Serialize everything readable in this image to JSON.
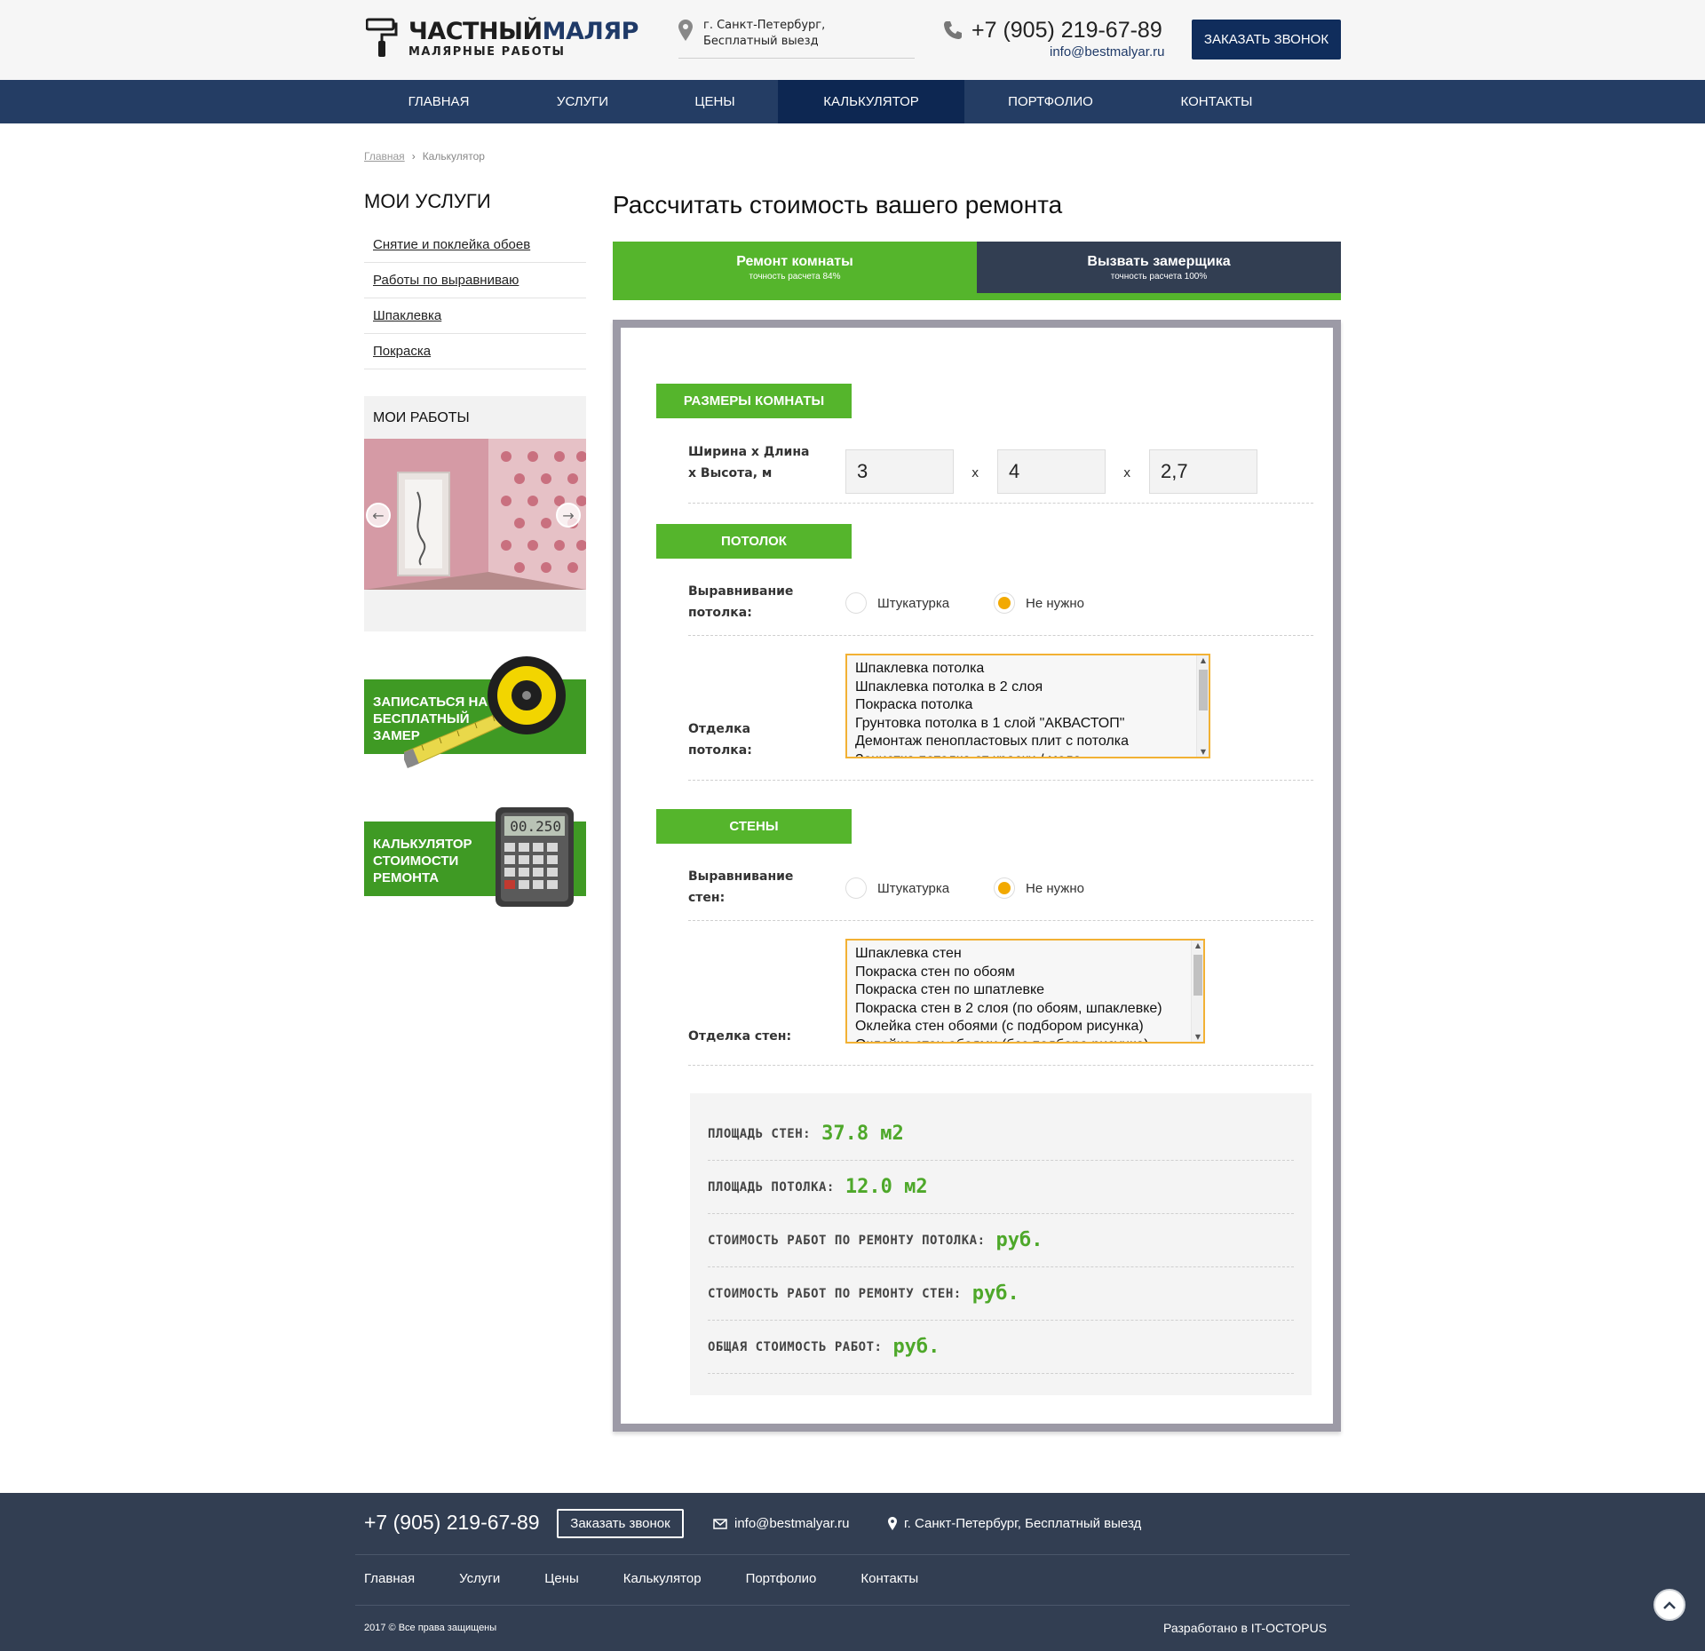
{
  "header": {
    "logo_part1": "ЧАСТНЫЙ",
    "logo_part2": "МАЛЯР",
    "logo_sub": "МАЛЯРНЫЕ РАБОТЫ",
    "location_line1": "г. Санкт-Петербург,",
    "location_line2": "Бесплатный выезд",
    "phone": "+7 (905) 219-67-89",
    "email": "info@bestmalyar.ru",
    "call_button": "ЗАКАЗАТЬ ЗВОНОК"
  },
  "nav": [
    {
      "label": "ГЛАВНАЯ"
    },
    {
      "label": "УСЛУГИ"
    },
    {
      "label": "ЦЕНЫ"
    },
    {
      "label": "КАЛЬКУЛЯТОР",
      "active": true
    },
    {
      "label": "ПОРТФОЛИО"
    },
    {
      "label": "КОНТАКТЫ"
    }
  ],
  "breadcrumb": {
    "home": "Главная",
    "current": "Калькулятор"
  },
  "sidebar": {
    "title": "МОИ УСЛУГИ",
    "items": [
      {
        "label": "Снятие и поклейка обоев"
      },
      {
        "label": "Работы по выравниваю"
      },
      {
        "label": "Шпаклевка"
      },
      {
        "label": "Покраска"
      }
    ],
    "works_title": "МОИ РАБОТЫ",
    "promo1": "ЗАПИСАТЬСЯ НА БЕСПЛАТНЫЙ ЗАМЕР",
    "promo2": "КАЛЬКУЛЯТОР СТОИМОСТИ РЕМОНТА",
    "calc_display": "00.250"
  },
  "main": {
    "title": "Рассчитать стоимость вашего ремонта",
    "tabs": [
      {
        "label": "Ремонт комнаты",
        "sub": "точность расчета 84%"
      },
      {
        "label": "Вызвать замерщика",
        "sub": "точность расчета 100%"
      }
    ],
    "room": {
      "header": "РАЗМЕРЫ КОМНАТЫ",
      "label_line1": "Ширина х Длина",
      "label_line2": "х Высота, м",
      "width": "3",
      "length": "4",
      "height": "2,7",
      "x": "х"
    },
    "ceiling": {
      "header": "ПОТОЛОК",
      "align_label_line1": "Выравнивание",
      "align_label_line2": "потолка:",
      "opt_plaster": "Штукатурка",
      "opt_none": "Не нужно",
      "selected": "Не нужно",
      "finish_label_line1": "Отделка",
      "finish_label_line2": "потолка:",
      "finish_options": [
        "Шпаклевка потолка",
        "Шпаклевка потолка в 2 слоя",
        "Покраска потолка",
        "Грунтовка потолка в 1 слой \"АКВАСТОП\"",
        "Демонтаж пенопластовых плит с потолка",
        "Зачистка потолка от краски / мела"
      ]
    },
    "walls": {
      "header": "СТЕНЫ",
      "align_label_line1": "Выравнивание",
      "align_label_line2": "стен:",
      "opt_plaster": "Штукатурка",
      "opt_none": "Не нужно",
      "selected": "Не нужно",
      "finish_label": "Отделка стен:",
      "finish_options": [
        "Шпаклевка стен",
        "Покраска стен по обоям",
        "Покраска стен по шпатлевке",
        "Покраска стен в 2 слоя (по обоям, шпаклевке)",
        "Оклейка стен обоями (с подбором рисунка)",
        "Оклейка стен обоями (без подбора рисунка)"
      ]
    },
    "results": [
      {
        "label": "ПЛОЩАДЬ СТЕН:",
        "value": "37.8 м2"
      },
      {
        "label": "ПЛОЩАДЬ ПОТОЛКА:",
        "value": "12.0 м2"
      },
      {
        "label": "СТОИМОСТЬ РАБОТ ПО РЕМОНТУ ПОТОЛКА:",
        "value": "руб."
      },
      {
        "label": "СТОИМОСТЬ РАБОТ ПО РЕМОНТУ СТЕН:",
        "value": "руб."
      },
      {
        "label": "ОБЩАЯ СТОИМОСТЬ РАБОТ:",
        "value": "руб."
      }
    ]
  },
  "footer": {
    "phone": "+7 (905) 219-67-89",
    "call_button": "Заказать звонок",
    "email": "info@bestmalyar.ru",
    "location": "г. Санкт-Петербург, Бесплатный выезд",
    "nav": [
      "Главная",
      "Услуги",
      "Цены",
      "Калькулятор",
      "Портфолио",
      "Контакты"
    ],
    "copyright": "2017 © Все права защищены",
    "developer": "Разработано в IT-OCTOPUS"
  },
  "colors": {
    "nav_bg": "#243d64",
    "nav_active": "#0d2752",
    "green": "#55b52c",
    "dark_tab": "#323e52",
    "orange": "#f2a900"
  }
}
